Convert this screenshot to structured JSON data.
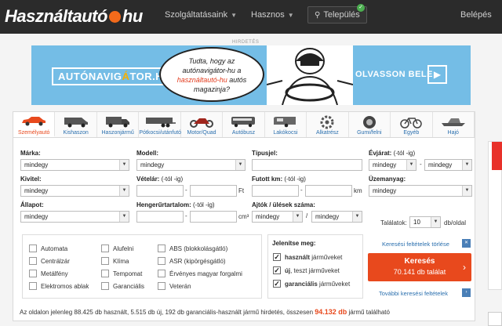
{
  "brand": {
    "left": "Használtautó",
    "right": "hu",
    "accent": "#f26a1b"
  },
  "nav": {
    "services": "Szolgáltatásaink",
    "useful": "Hasznos",
    "location": "Település",
    "login": "Belépés"
  },
  "ad": {
    "label": "HIRDETÉS",
    "logo_left": "AUTÓNAVIG",
    "logo_mid": "Á",
    "logo_right": "TOR.HU",
    "bubble_l1": "Tudta, hogy az",
    "bubble_l2": "autónavigátor-hu a",
    "bubble_l3a": "használtautó-hu",
    "bubble_l3b": " autós",
    "bubble_l4": "magazinja?",
    "cta": "OLVASSON BELE",
    "cta_arrow": "▶"
  },
  "tabs": [
    {
      "label": "Személyautó",
      "icon": "car-icon",
      "active": true
    },
    {
      "label": "Kishaszon",
      "icon": "van-icon"
    },
    {
      "label": "Haszonjármű",
      "icon": "truck-icon"
    },
    {
      "label": "Pótkocsi/utánfutó",
      "icon": "trailer-icon"
    },
    {
      "label": "Motor/Quad",
      "icon": "motorbike-icon"
    },
    {
      "label": "Autóbusz",
      "icon": "bus-icon"
    },
    {
      "label": "Lakókocsi",
      "icon": "caravan-icon"
    },
    {
      "label": "Alkatrész",
      "icon": "part-icon"
    },
    {
      "label": "Gumi/felni",
      "icon": "tire-icon"
    },
    {
      "label": "Egyéb",
      "icon": "bicycle-icon"
    },
    {
      "label": "Hajó",
      "icon": "boat-icon"
    }
  ],
  "form": {
    "make": {
      "label": "Márka:",
      "value": "mindegy"
    },
    "model": {
      "label": "Modell:",
      "value": "mindegy"
    },
    "type": {
      "label": "Típusjel:"
    },
    "year": {
      "label": "Évjárat:",
      "hint": " (-tól -ig)",
      "from": "mindegy",
      "to": "mindegy"
    },
    "body": {
      "label": "Kivitel:",
      "value": "mindegy"
    },
    "price": {
      "label": "Vételár:",
      "hint": " (-tól -ig)",
      "unit": "Ft"
    },
    "km": {
      "label": "Futott km:",
      "hint": " (-tól -ig)",
      "unit": "km"
    },
    "fuel": {
      "label": "Üzemanyag:",
      "value": "mindegy"
    },
    "condition": {
      "label": "Állapot:",
      "value": "mindegy"
    },
    "engine": {
      "label": "Hengerűrtartalom:",
      "hint": " (-tól -ig)",
      "unit": "cm³"
    },
    "doors": {
      "label": "Ajtók / ülések száma:",
      "doors": "mindegy",
      "sep": "/",
      "seats": "mindegy"
    },
    "results_per_page": {
      "label": "Találatok:",
      "value": "10",
      "unit": "db/oldal"
    }
  },
  "options": [
    [
      "Automata",
      "Alufelni",
      "ABS (blokkolásgátló)"
    ],
    [
      "Centrálzár",
      "Klíma",
      "ASR (kipörgésgátló)"
    ],
    [
      "Metálfény",
      "Tempomat",
      "Érvényes magyar forgalmi"
    ],
    [
      "Elektromos ablak",
      "Garanciális",
      "Veterán"
    ]
  ],
  "show": {
    "title": "Jelenítse meg:",
    "items": [
      {
        "bold": "használt",
        "rest": " járműveket"
      },
      {
        "bold": "új",
        "rest": ", teszt járműveket"
      },
      {
        "bold": "garanciális",
        "rest": " járműveket"
      }
    ]
  },
  "actions": {
    "clear": "Keresési feltételek törlése",
    "search_title": "Keresés",
    "search_count": "70.141 db találat",
    "more": "További keresési feltételek"
  },
  "summary": {
    "prefix": "Az oldalon jelenleg 88.425 db használt, 5.515 db új, 192 db garanciális-használt jármű hirdetés, összesen ",
    "total": "94.132 db",
    "suffix": " jármű található"
  },
  "colors": {
    "accent": "#e8491d",
    "link": "#2a6fae",
    "banner": "#74bde6"
  }
}
